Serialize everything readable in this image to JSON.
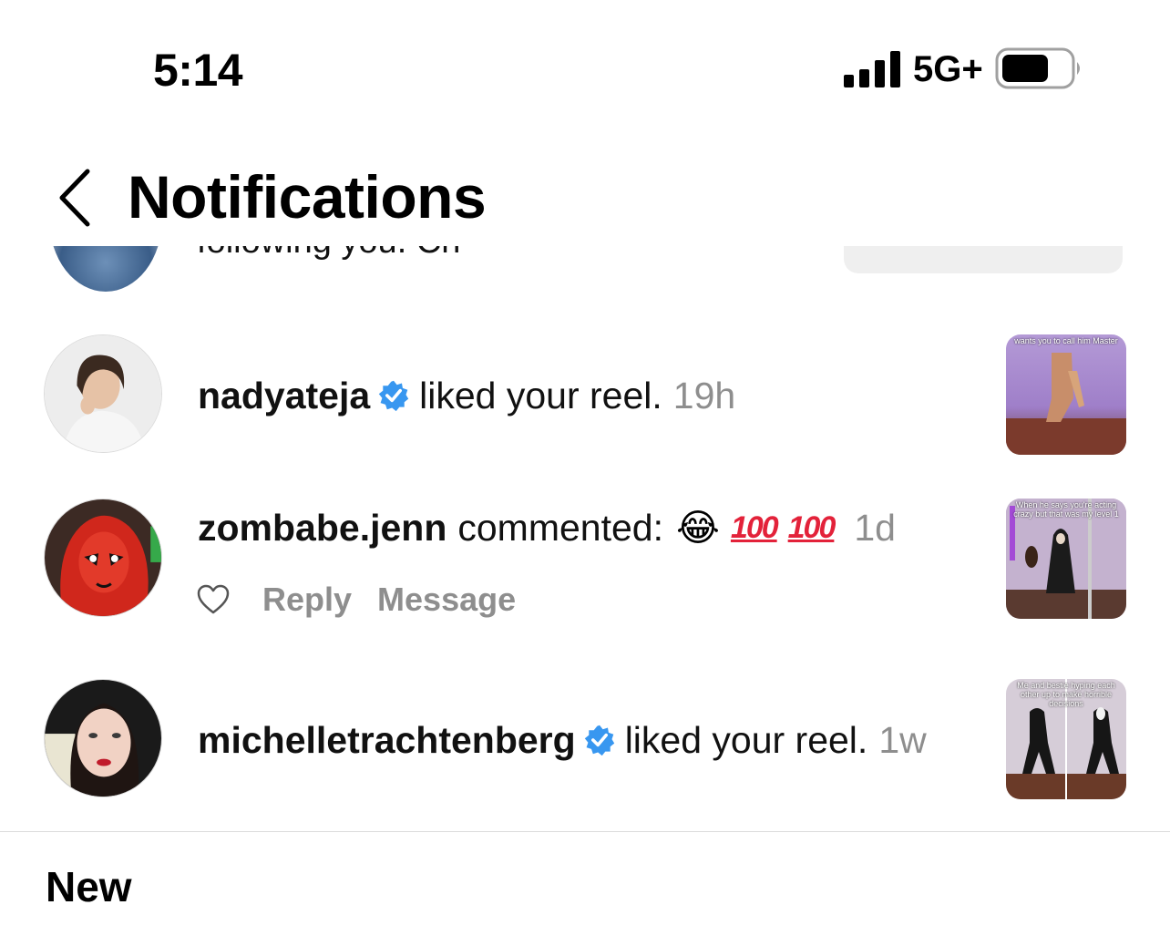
{
  "status_bar": {
    "time": "5:14",
    "network": "5G+"
  },
  "header": {
    "title": "Notifications"
  },
  "clipped_row": {
    "text": "following you. Ch"
  },
  "notifications": [
    {
      "username": "nadyateja",
      "verified": true,
      "action": "liked your reel.",
      "time": "19h",
      "thumb_caption": "wants you to call him Master"
    },
    {
      "username": "zombabe.jenn",
      "verified": false,
      "action": "commented:",
      "comment_emojis": [
        "😂",
        "100",
        "100"
      ],
      "time": "1d",
      "reply_label": "Reply",
      "message_label": "Message",
      "thumb_caption": "When he says you're acting crazy but that was my level 1"
    },
    {
      "username": "michelletrachtenberg",
      "verified": true,
      "action": "liked your reel.",
      "time": "1w",
      "thumb_caption": "Me and bestie hyping each other up to make horrible decisions"
    }
  ],
  "sections": {
    "new_label": "New"
  },
  "colors": {
    "verified": "#3897f0",
    "muted": "#8e8e8e",
    "hundred": "#e3223a"
  }
}
